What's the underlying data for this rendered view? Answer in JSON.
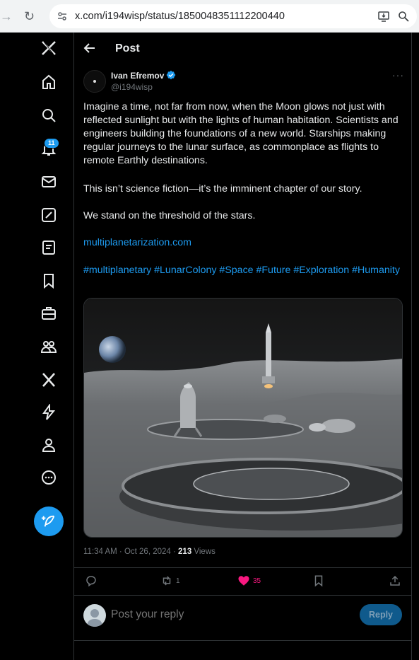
{
  "browser": {
    "url": "x.com/i194wisp/status/1850048351112200440"
  },
  "sidebar": {
    "notifications_badge": "11"
  },
  "header": {
    "title": "Post"
  },
  "post": {
    "author_name": "Ivan Efremov",
    "author_handle": "@i194wisp",
    "more_label": "···",
    "paragraph1": "Imagine a time, not far from now, when the Moon glows not just with reflected sunlight but with the lights of human habitation. Scientists and engineers building the foundations of a new world. Starships making regular journeys to the lunar surface, as commonplace as flights to remote Earthly destinations.",
    "paragraph2": "This isn’t science fiction—it’s the imminent chapter of our story.",
    "paragraph3": "We stand on the threshold of the stars.",
    "link": "multiplanetarization.com",
    "hashtags": "#multiplanetary #LunarColony #Space #Future #Exploration #Humanity",
    "timestamp": "11:34 AM · Oct 26, 2024 · ",
    "views_count": "213",
    "views_label": " Views"
  },
  "actions": {
    "retweets": "1",
    "likes": "35"
  },
  "reply": {
    "placeholder": "Post your reply",
    "button_label": "Reply"
  },
  "colors": {
    "accent": "#1d9bf0",
    "like": "#f91880",
    "background": "#000000",
    "border": "#2f3336"
  }
}
